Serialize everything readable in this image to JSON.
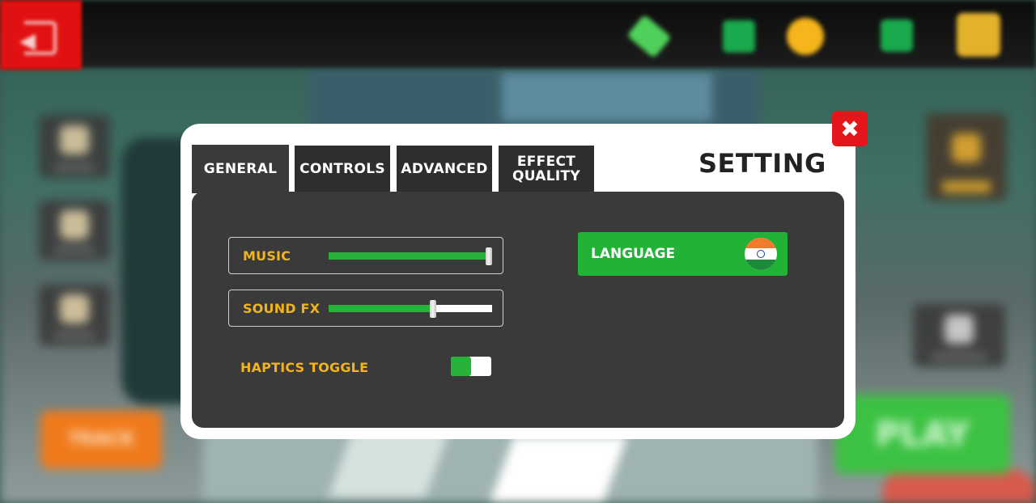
{
  "theme": {
    "accent_green": "#27b33a",
    "label_yellow": "#f2b41c",
    "close_red": "#e4161c",
    "panel_dark": "#3a3a3a"
  },
  "topbar": {
    "exit_icon": "exit-icon",
    "cash_icon": "cash-icon",
    "coin_icon": "coin-icon",
    "shop_icon": "shop-icon"
  },
  "background": {
    "track_label": "TRACK",
    "play_label": "PLAY"
  },
  "settings": {
    "title": "SETTING",
    "close_glyph": "✖",
    "tabs": [
      {
        "label": "GENERAL",
        "active": true
      },
      {
        "label": "CONTROLS",
        "active": false
      },
      {
        "label": "ADVANCED",
        "active": false
      },
      {
        "label": "EFFECT\nQUALITY",
        "active": false
      }
    ],
    "music": {
      "label": "MUSIC",
      "level": 1.0
    },
    "sound_fx": {
      "label": "SOUND FX",
      "level": 0.64
    },
    "haptics": {
      "label": "HAPTICS TOGGLE",
      "enabled": true
    },
    "language": {
      "label": "LANGUAGE",
      "flag_icon": "india-flag-icon"
    }
  }
}
